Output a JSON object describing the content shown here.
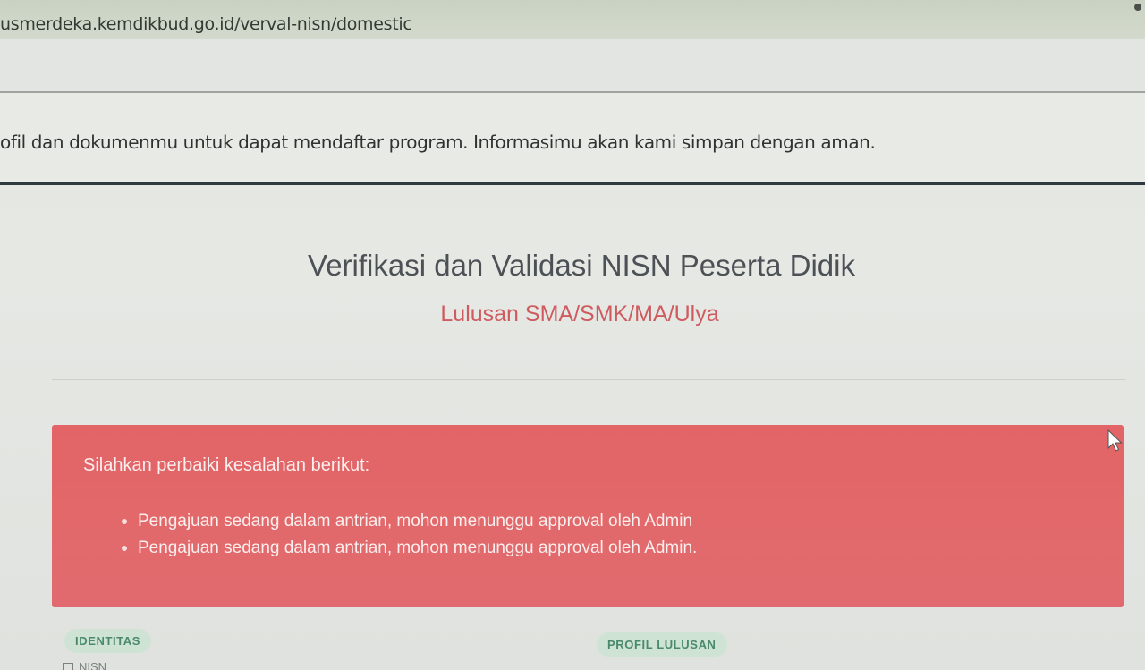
{
  "browser": {
    "url": "usmerdeka.kemdikbud.go.id/verval-nisn/domestic"
  },
  "info_banner": {
    "text": "ofil dan dokumenmu untuk dapat mendaftar program. Informasimu akan kami simpan dengan aman."
  },
  "page": {
    "title": "Verifikasi dan Validasi NISN Peserta Didik",
    "subtitle": "Lulusan SMA/SMK/MA/Ulya"
  },
  "alert": {
    "heading": "Silahkan perbaiki kesalahan berikut:",
    "items": [
      "Pengajuan sedang dalam antrian, mohon menunggu approval oleh Admin",
      "Pengajuan sedang dalam antrian, mohon menunggu approval oleh Admin."
    ],
    "color": "#e2676a"
  },
  "tabs": {
    "identitas": "IDENTITAS",
    "profil_lulusan": "PROFIL LULUSAN"
  },
  "form": {
    "nisn_label": "NISN"
  },
  "icons": {
    "cursor": "mouse-pointer-icon",
    "nisn": "id-card-icon"
  }
}
